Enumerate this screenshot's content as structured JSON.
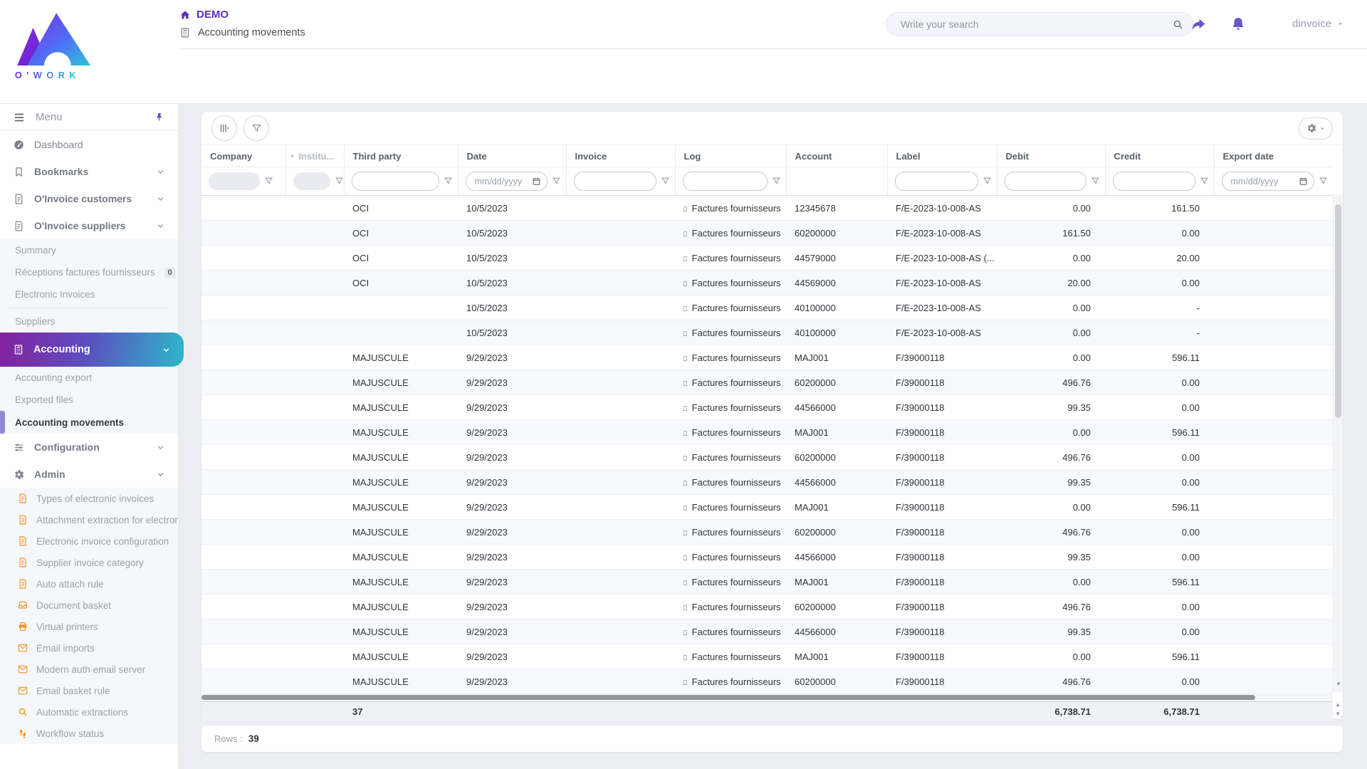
{
  "topbar": {
    "brand": "O'WORK",
    "breadcrumb_home": "DEMO",
    "page_title": "Accounting movements",
    "search_placeholder": "Write your search",
    "username": "dinvoice"
  },
  "colors": {
    "accent_purple": "#5b2fc0",
    "icon_purple": "#6456c8",
    "sidebar_orange": "#f0941e",
    "gradient_start": "#84219f",
    "gradient_end": "#2db8c8"
  },
  "sidebar": {
    "menu_label": "Menu",
    "items": [
      {
        "label": "Dashboard",
        "icon": "gauge",
        "style": "item"
      },
      {
        "label": "Bookmarks",
        "icon": "bookmark",
        "style": "item-bold",
        "chevron": true
      },
      {
        "label": "O'Invoice customers",
        "icon": "doc",
        "style": "item-bold",
        "chevron": true
      },
      {
        "label": "O'Invoice suppliers",
        "icon": "doc",
        "style": "item-bold",
        "chevron": true
      },
      {
        "label": "Summary",
        "style": "sub"
      },
      {
        "label": "Réceptions factures fournisseurs",
        "style": "sub",
        "badge": "0"
      },
      {
        "label": "Electronic Invoices",
        "style": "sub"
      },
      {
        "label": "Suppliers",
        "style": "sub",
        "divider_before": true
      },
      {
        "label": "Accounting",
        "icon": "calc",
        "style": "active-gradient",
        "chevron": true
      },
      {
        "label": "Accounting export",
        "style": "sub"
      },
      {
        "label": "Exported files",
        "style": "sub"
      },
      {
        "label": "Accounting movements",
        "style": "sub-active"
      },
      {
        "label": "Configuration",
        "icon": "sliders",
        "style": "item-bold",
        "chevron": true
      },
      {
        "label": "Admin",
        "icon": "gear",
        "style": "item-bold",
        "chevron": true
      },
      {
        "label": "Types of electronic invoices",
        "icon": "doc",
        "style": "sub-icon"
      },
      {
        "label": "Attachment extraction for electroni",
        "icon": "doc",
        "style": "sub-icon"
      },
      {
        "label": "Electronic invoice configuration",
        "icon": "doc",
        "style": "sub-icon"
      },
      {
        "label": "Supplier invoice category",
        "icon": "doc",
        "style": "sub-icon"
      },
      {
        "label": "Auto attach rule",
        "icon": "doc",
        "style": "sub-icon"
      },
      {
        "label": "Document basket",
        "icon": "inbox",
        "style": "sub-icon"
      },
      {
        "label": "Virtual printers",
        "icon": "printer",
        "style": "sub-icon"
      },
      {
        "label": "Email imports",
        "icon": "mail",
        "style": "sub-icon"
      },
      {
        "label": "Modern auth email server",
        "icon": "mail",
        "style": "sub-icon"
      },
      {
        "label": "Email basket rule",
        "icon": "mail",
        "style": "sub-icon"
      },
      {
        "label": "Automatic extractions",
        "icon": "search",
        "style": "sub-icon"
      },
      {
        "label": "Workflow status",
        "icon": "steps",
        "style": "sub-icon"
      }
    ]
  },
  "table": {
    "date_placeholder": "mm/dd/yyyy",
    "log_glyph": "□",
    "columns": [
      {
        "key": "company",
        "label": "Company",
        "filter": "disabled"
      },
      {
        "key": "institution",
        "label": "Institu...",
        "filter": "disabled-sm",
        "muted": true,
        "group_chevron": true
      },
      {
        "key": "third_party",
        "label": "Third party",
        "filter": "text"
      },
      {
        "key": "date",
        "label": "Date",
        "filter": "date"
      },
      {
        "key": "invoice",
        "label": "Invoice",
        "filter": "text"
      },
      {
        "key": "log",
        "label": "Log",
        "filter": "text"
      },
      {
        "key": "account",
        "label": "Account",
        "filter": "none"
      },
      {
        "key": "label",
        "label": "Label",
        "filter": "text"
      },
      {
        "key": "debit",
        "label": "Debit",
        "filter": "text"
      },
      {
        "key": "credit",
        "label": "Credit",
        "filter": "text"
      },
      {
        "key": "export_date",
        "label": "Export date",
        "filter": "date"
      }
    ],
    "rows": [
      {
        "third_party": "OCI",
        "date": "10/5/2023",
        "log": "Factures fournisseurs",
        "account": "12345678",
        "label": "F/E-2023-10-008-AS",
        "debit": "0.00",
        "credit": "161.50"
      },
      {
        "third_party": "OCI",
        "date": "10/5/2023",
        "log": "Factures fournisseurs",
        "account": "60200000",
        "label": "F/E-2023-10-008-AS",
        "debit": "161.50",
        "credit": "0.00"
      },
      {
        "third_party": "OCI",
        "date": "10/5/2023",
        "log": "Factures fournisseurs",
        "account": "44579000",
        "label": "F/E-2023-10-008-AS (...",
        "debit": "0.00",
        "credit": "20.00"
      },
      {
        "third_party": "OCI",
        "date": "10/5/2023",
        "log": "Factures fournisseurs",
        "account": "44569000",
        "label": "F/E-2023-10-008-AS",
        "debit": "20.00",
        "credit": "0.00"
      },
      {
        "third_party": "",
        "date": "10/5/2023",
        "log": "Factures fournisseurs",
        "account": "40100000",
        "label": "F/E-2023-10-008-AS",
        "debit": "0.00",
        "credit": "-"
      },
      {
        "third_party": "",
        "date": "10/5/2023",
        "log": "Factures fournisseurs",
        "account": "40100000",
        "label": "F/E-2023-10-008-AS",
        "debit": "0.00",
        "credit": "-"
      },
      {
        "third_party": "MAJUSCULE",
        "date": "9/29/2023",
        "log": "Factures fournisseurs",
        "account": "MAJ001",
        "label": "F/39000118",
        "debit": "0.00",
        "credit": "596.11"
      },
      {
        "third_party": "MAJUSCULE",
        "date": "9/29/2023",
        "log": "Factures fournisseurs",
        "account": "60200000",
        "label": "F/39000118",
        "debit": "496.76",
        "credit": "0.00"
      },
      {
        "third_party": "MAJUSCULE",
        "date": "9/29/2023",
        "log": "Factures fournisseurs",
        "account": "44566000",
        "label": "F/39000118",
        "debit": "99.35",
        "credit": "0.00"
      },
      {
        "third_party": "MAJUSCULE",
        "date": "9/29/2023",
        "log": "Factures fournisseurs",
        "account": "MAJ001",
        "label": "F/39000118",
        "debit": "0.00",
        "credit": "596.11"
      },
      {
        "third_party": "MAJUSCULE",
        "date": "9/29/2023",
        "log": "Factures fournisseurs",
        "account": "60200000",
        "label": "F/39000118",
        "debit": "496.76",
        "credit": "0.00"
      },
      {
        "third_party": "MAJUSCULE",
        "date": "9/29/2023",
        "log": "Factures fournisseurs",
        "account": "44566000",
        "label": "F/39000118",
        "debit": "99.35",
        "credit": "0.00"
      },
      {
        "third_party": "MAJUSCULE",
        "date": "9/29/2023",
        "log": "Factures fournisseurs",
        "account": "MAJ001",
        "label": "F/39000118",
        "debit": "0.00",
        "credit": "596.11"
      },
      {
        "third_party": "MAJUSCULE",
        "date": "9/29/2023",
        "log": "Factures fournisseurs",
        "account": "60200000",
        "label": "F/39000118",
        "debit": "496.76",
        "credit": "0.00"
      },
      {
        "third_party": "MAJUSCULE",
        "date": "9/29/2023",
        "log": "Factures fournisseurs",
        "account": "44566000",
        "label": "F/39000118",
        "debit": "99.35",
        "credit": "0.00"
      },
      {
        "third_party": "MAJUSCULE",
        "date": "9/29/2023",
        "log": "Factures fournisseurs",
        "account": "MAJ001",
        "label": "F/39000118",
        "debit": "0.00",
        "credit": "596.11"
      },
      {
        "third_party": "MAJUSCULE",
        "date": "9/29/2023",
        "log": "Factures fournisseurs",
        "account": "60200000",
        "label": "F/39000118",
        "debit": "496.76",
        "credit": "0.00"
      },
      {
        "third_party": "MAJUSCULE",
        "date": "9/29/2023",
        "log": "Factures fournisseurs",
        "account": "44566000",
        "label": "F/39000118",
        "debit": "99.35",
        "credit": "0.00"
      },
      {
        "third_party": "MAJUSCULE",
        "date": "9/29/2023",
        "log": "Factures fournisseurs",
        "account": "MAJ001",
        "label": "F/39000118",
        "debit": "0.00",
        "credit": "596.11"
      },
      {
        "third_party": "MAJUSCULE",
        "date": "9/29/2023",
        "log": "Factures fournisseurs",
        "account": "60200000",
        "label": "F/39000118",
        "debit": "496.76",
        "credit": "0.00"
      }
    ],
    "totals": {
      "third_party": "37",
      "debit": "6,738.71",
      "credit": "6,738.71"
    },
    "footer": {
      "rows_label": "Rows :",
      "rows_count": "39"
    }
  }
}
